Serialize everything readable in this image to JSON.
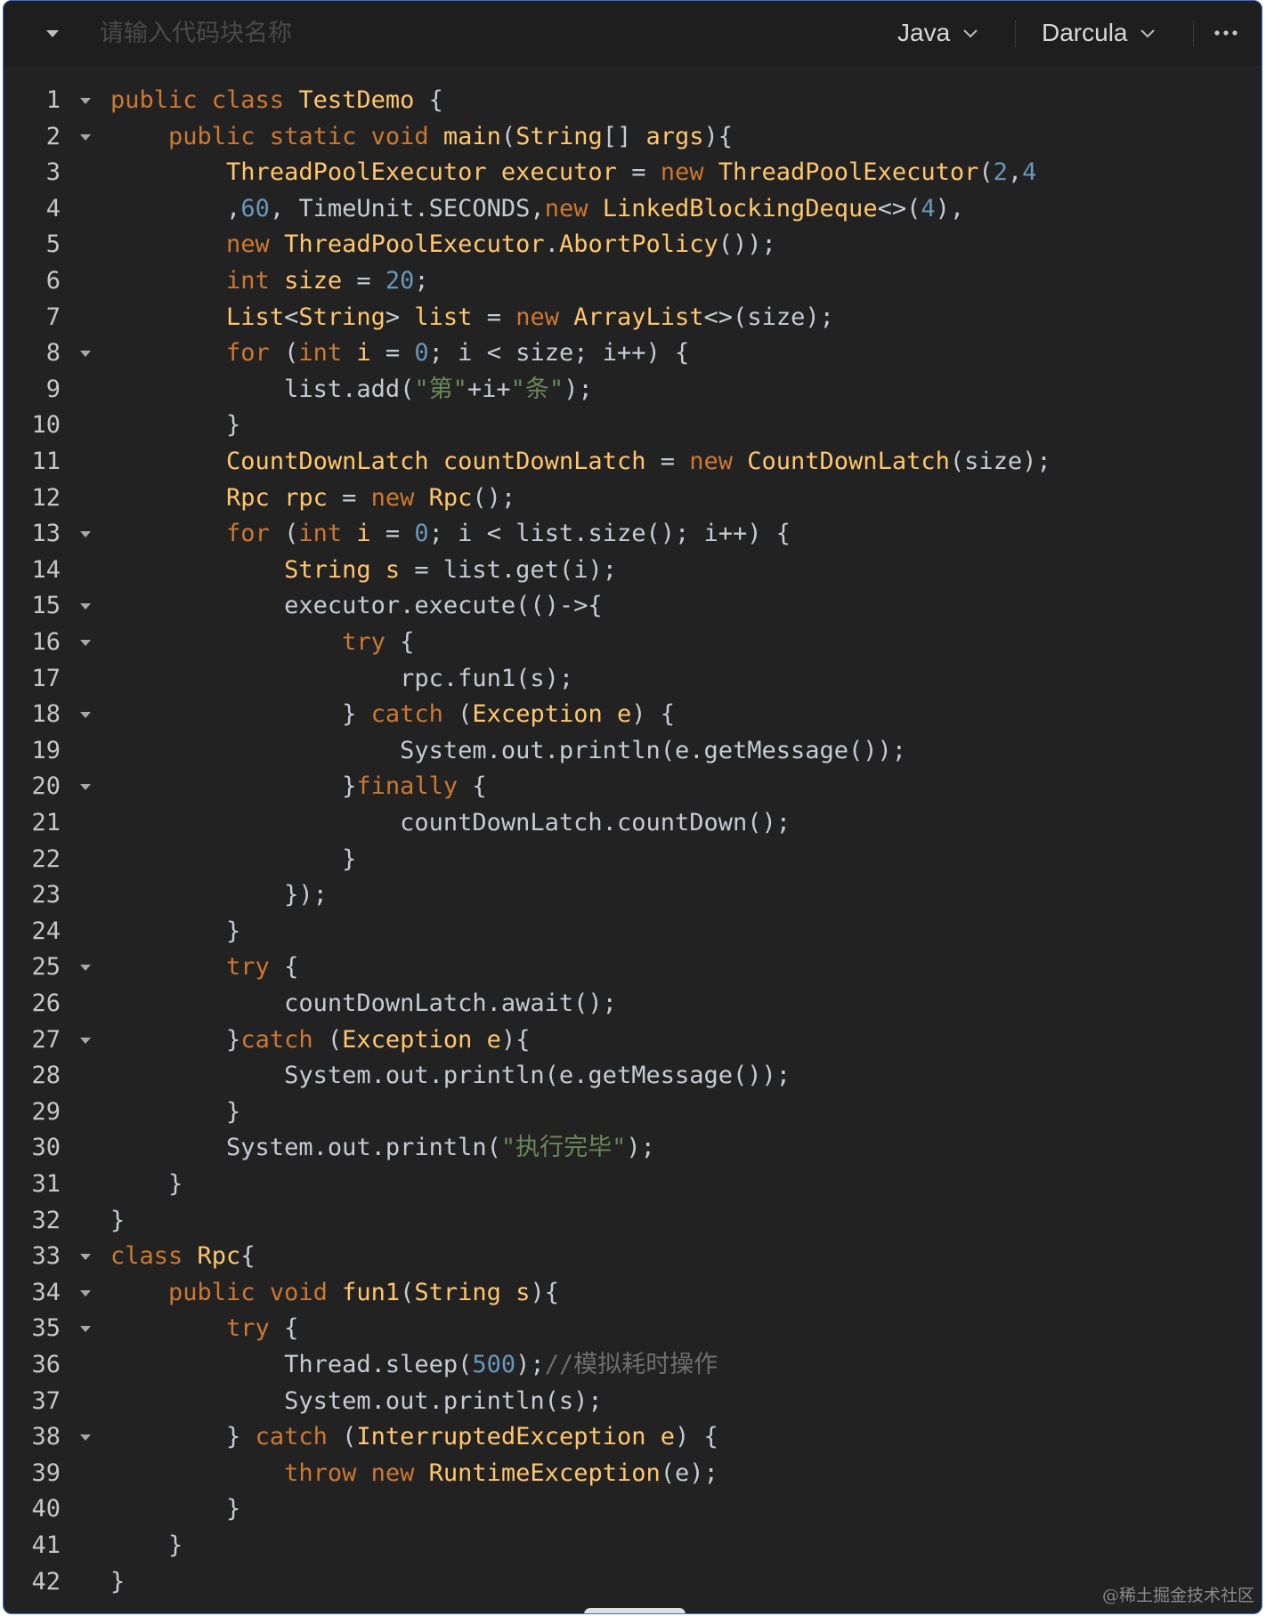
{
  "toolbar": {
    "name_placeholder": "请输入代码块名称",
    "language": "Java",
    "theme": "Darcula"
  },
  "colors": {
    "background": "#222222",
    "keyword": "#cc7832",
    "type": "#ffc66d",
    "number": "#6897bb",
    "string": "#6a8759",
    "comment": "#6e6e6e",
    "text": "#c7cbd1",
    "frame_border": "#3a6fd8"
  },
  "code": {
    "language": "java",
    "lines": [
      {
        "n": "1",
        "fold": true,
        "tokens": [
          [
            "k",
            "public class "
          ],
          [
            "t",
            "TestDemo "
          ],
          [
            "p",
            "{"
          ]
        ]
      },
      {
        "n": "2",
        "fold": true,
        "tokens": [
          [
            "p",
            "    "
          ],
          [
            "k",
            "public static void "
          ],
          [
            "t",
            "main"
          ],
          [
            "p",
            "("
          ],
          [
            "t",
            "String"
          ],
          [
            "p",
            "[] "
          ],
          [
            "t",
            "args"
          ],
          [
            "p",
            "){"
          ]
        ]
      },
      {
        "n": "3",
        "fold": false,
        "tokens": [
          [
            "p",
            "        "
          ],
          [
            "t",
            "ThreadPoolExecutor executor "
          ],
          [
            "p",
            "= "
          ],
          [
            "k",
            "new "
          ],
          [
            "t",
            "ThreadPoolExecutor"
          ],
          [
            "p",
            "("
          ],
          [
            "n",
            "2"
          ],
          [
            "p",
            ","
          ],
          [
            "n",
            "4"
          ]
        ]
      },
      {
        "n": "4",
        "fold": false,
        "tokens": [
          [
            "p",
            "        ,"
          ],
          [
            "n",
            "60"
          ],
          [
            "p",
            ", TimeUnit.SECONDS,"
          ],
          [
            "k",
            "new "
          ],
          [
            "t",
            "LinkedBlockingDeque"
          ],
          [
            "p",
            "<>("
          ],
          [
            "n",
            "4"
          ],
          [
            "p",
            "),"
          ]
        ]
      },
      {
        "n": "5",
        "fold": false,
        "tokens": [
          [
            "p",
            "        "
          ],
          [
            "k",
            "new "
          ],
          [
            "t",
            "ThreadPoolExecutor"
          ],
          [
            "p",
            "."
          ],
          [
            "t",
            "AbortPolicy"
          ],
          [
            "p",
            "());"
          ]
        ]
      },
      {
        "n": "6",
        "fold": false,
        "tokens": [
          [
            "p",
            "        "
          ],
          [
            "k",
            "int "
          ],
          [
            "t",
            "size "
          ],
          [
            "p",
            "= "
          ],
          [
            "n",
            "20"
          ],
          [
            "p",
            ";"
          ]
        ]
      },
      {
        "n": "7",
        "fold": false,
        "tokens": [
          [
            "p",
            "        "
          ],
          [
            "t",
            "List"
          ],
          [
            "p",
            "<"
          ],
          [
            "t",
            "String"
          ],
          [
            "p",
            "> "
          ],
          [
            "t",
            "list "
          ],
          [
            "p",
            "= "
          ],
          [
            "k",
            "new "
          ],
          [
            "t",
            "ArrayList"
          ],
          [
            "p",
            "<>(size);"
          ]
        ]
      },
      {
        "n": "8",
        "fold": true,
        "tokens": [
          [
            "p",
            "        "
          ],
          [
            "k",
            "for "
          ],
          [
            "p",
            "("
          ],
          [
            "k",
            "int "
          ],
          [
            "t",
            "i "
          ],
          [
            "p",
            "= "
          ],
          [
            "n",
            "0"
          ],
          [
            "p",
            "; i < size; i++) {"
          ]
        ]
      },
      {
        "n": "9",
        "fold": false,
        "tokens": [
          [
            "p",
            "            list.add("
          ],
          [
            "s",
            "\"第\""
          ],
          [
            "p",
            "+i+"
          ],
          [
            "s",
            "\"条\""
          ],
          [
            "p",
            ");"
          ]
        ]
      },
      {
        "n": "10",
        "fold": false,
        "tokens": [
          [
            "p",
            "        }"
          ]
        ]
      },
      {
        "n": "11",
        "fold": false,
        "tokens": [
          [
            "p",
            "        "
          ],
          [
            "t",
            "CountDownLatch countDownLatch "
          ],
          [
            "p",
            "= "
          ],
          [
            "k",
            "new "
          ],
          [
            "t",
            "CountDownLatch"
          ],
          [
            "p",
            "(size);"
          ]
        ]
      },
      {
        "n": "12",
        "fold": false,
        "tokens": [
          [
            "p",
            "        "
          ],
          [
            "t",
            "Rpc rpc "
          ],
          [
            "p",
            "= "
          ],
          [
            "k",
            "new "
          ],
          [
            "t",
            "Rpc"
          ],
          [
            "p",
            "();"
          ]
        ]
      },
      {
        "n": "13",
        "fold": true,
        "tokens": [
          [
            "p",
            "        "
          ],
          [
            "k",
            "for "
          ],
          [
            "p",
            "("
          ],
          [
            "k",
            "int "
          ],
          [
            "t",
            "i "
          ],
          [
            "p",
            "= "
          ],
          [
            "n",
            "0"
          ],
          [
            "p",
            "; i < list.size(); i++) {"
          ]
        ]
      },
      {
        "n": "14",
        "fold": false,
        "tokens": [
          [
            "p",
            "            "
          ],
          [
            "t",
            "String s "
          ],
          [
            "p",
            "= list.get(i);"
          ]
        ]
      },
      {
        "n": "15",
        "fold": true,
        "tokens": [
          [
            "p",
            "            executor.execute(()->{"
          ]
        ]
      },
      {
        "n": "16",
        "fold": true,
        "tokens": [
          [
            "p",
            "                "
          ],
          [
            "k",
            "try "
          ],
          [
            "p",
            "{"
          ]
        ]
      },
      {
        "n": "17",
        "fold": false,
        "tokens": [
          [
            "p",
            "                    rpc.fun1(s);"
          ]
        ]
      },
      {
        "n": "18",
        "fold": true,
        "tokens": [
          [
            "p",
            "                } "
          ],
          [
            "k",
            "catch "
          ],
          [
            "p",
            "("
          ],
          [
            "t",
            "Exception e"
          ],
          [
            "p",
            ") {"
          ]
        ]
      },
      {
        "n": "19",
        "fold": false,
        "tokens": [
          [
            "p",
            "                    System.out.println(e.getMessage());"
          ]
        ]
      },
      {
        "n": "20",
        "fold": true,
        "tokens": [
          [
            "p",
            "                }"
          ],
          [
            "k",
            "finally "
          ],
          [
            "p",
            "{"
          ]
        ]
      },
      {
        "n": "21",
        "fold": false,
        "tokens": [
          [
            "p",
            "                    countDownLatch.countDown();"
          ]
        ]
      },
      {
        "n": "22",
        "fold": false,
        "tokens": [
          [
            "p",
            "                }"
          ]
        ]
      },
      {
        "n": "23",
        "fold": false,
        "tokens": [
          [
            "p",
            "            });"
          ]
        ]
      },
      {
        "n": "24",
        "fold": false,
        "tokens": [
          [
            "p",
            "        }"
          ]
        ]
      },
      {
        "n": "25",
        "fold": true,
        "tokens": [
          [
            "p",
            "        "
          ],
          [
            "k",
            "try "
          ],
          [
            "p",
            "{"
          ]
        ]
      },
      {
        "n": "26",
        "fold": false,
        "tokens": [
          [
            "p",
            "            countDownLatch.await();"
          ]
        ]
      },
      {
        "n": "27",
        "fold": true,
        "tokens": [
          [
            "p",
            "        }"
          ],
          [
            "k",
            "catch "
          ],
          [
            "p",
            "("
          ],
          [
            "t",
            "Exception e"
          ],
          [
            "p",
            "){"
          ]
        ]
      },
      {
        "n": "28",
        "fold": false,
        "tokens": [
          [
            "p",
            "            System.out.println(e.getMessage());"
          ]
        ]
      },
      {
        "n": "29",
        "fold": false,
        "tokens": [
          [
            "p",
            "        }"
          ]
        ]
      },
      {
        "n": "30",
        "fold": false,
        "tokens": [
          [
            "p",
            "        System.out.println("
          ],
          [
            "s",
            "\"执行完毕\""
          ],
          [
            "p",
            ");"
          ]
        ]
      },
      {
        "n": "31",
        "fold": false,
        "tokens": [
          [
            "p",
            "    }"
          ]
        ]
      },
      {
        "n": "32",
        "fold": false,
        "tokens": [
          [
            "p",
            "}"
          ]
        ]
      },
      {
        "n": "33",
        "fold": true,
        "tokens": [
          [
            "k",
            "class "
          ],
          [
            "t",
            "Rpc"
          ],
          [
            "p",
            "{"
          ]
        ]
      },
      {
        "n": "34",
        "fold": true,
        "tokens": [
          [
            "p",
            "    "
          ],
          [
            "k",
            "public void "
          ],
          [
            "t",
            "fun1"
          ],
          [
            "p",
            "("
          ],
          [
            "t",
            "String s"
          ],
          [
            "p",
            "){"
          ]
        ]
      },
      {
        "n": "35",
        "fold": true,
        "tokens": [
          [
            "p",
            "        "
          ],
          [
            "k",
            "try "
          ],
          [
            "p",
            "{"
          ]
        ]
      },
      {
        "n": "36",
        "fold": false,
        "tokens": [
          [
            "p",
            "            Thread.sleep("
          ],
          [
            "n",
            "500"
          ],
          [
            "p",
            ");"
          ],
          [
            "c",
            "//模拟耗时操作"
          ]
        ]
      },
      {
        "n": "37",
        "fold": false,
        "tokens": [
          [
            "p",
            "            System.out.println(s);"
          ]
        ]
      },
      {
        "n": "38",
        "fold": true,
        "tokens": [
          [
            "p",
            "        } "
          ],
          [
            "k",
            "catch "
          ],
          [
            "p",
            "("
          ],
          [
            "t",
            "InterruptedException e"
          ],
          [
            "p",
            ") {"
          ]
        ]
      },
      {
        "n": "39",
        "fold": false,
        "tokens": [
          [
            "p",
            "            "
          ],
          [
            "k",
            "throw new "
          ],
          [
            "t",
            "RuntimeException"
          ],
          [
            "p",
            "(e);"
          ]
        ]
      },
      {
        "n": "40",
        "fold": false,
        "tokens": [
          [
            "p",
            "        }"
          ]
        ]
      },
      {
        "n": "41",
        "fold": false,
        "tokens": [
          [
            "p",
            "    }"
          ]
        ]
      },
      {
        "n": "42",
        "fold": false,
        "tokens": [
          [
            "p",
            "}"
          ]
        ]
      }
    ]
  },
  "watermark": "@稀土掘金技术社区"
}
